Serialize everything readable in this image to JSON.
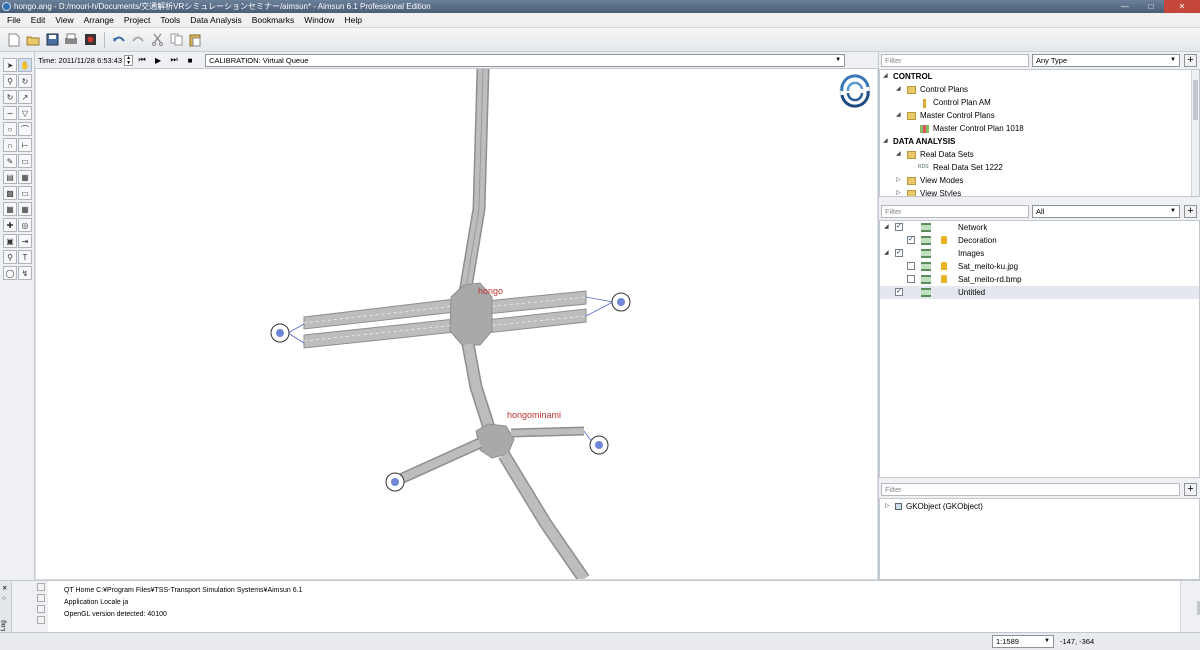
{
  "window": {
    "title": "hongo.ang - D:/mouri-h/Documents/交通解析VRシミュレーションセミナー/aimsun* - Aimsun 6.1 Professional Edition"
  },
  "menu": [
    "File",
    "Edit",
    "View",
    "Arrange",
    "Project",
    "Tools",
    "Data Analysis",
    "Bookmarks",
    "Window",
    "Help"
  ],
  "timebar": {
    "time_label": "Time: 2011/11/28 6:53:43",
    "experiment": "CALIBRATION: Virtual Queue"
  },
  "map": {
    "labels": {
      "node1": "hongo",
      "node2": "hongominami"
    }
  },
  "project_panel": {
    "filter_placeholder": "Filter",
    "type_select": "Any Type",
    "items": [
      {
        "label": "CONTROL"
      },
      {
        "label": "Control Plans"
      },
      {
        "label": "Control Plan AM"
      },
      {
        "label": "Master Control Plans"
      },
      {
        "label": "Master Control Plan 1018"
      },
      {
        "label": "DATA ANALYSIS"
      },
      {
        "label": "Real Data Sets"
      },
      {
        "label": "Real Data Set 1222",
        "badge": "RDS"
      },
      {
        "label": "View Modes"
      },
      {
        "label": "View Styles"
      }
    ]
  },
  "layers_panel": {
    "filter_placeholder": "Filter",
    "type_select": "All",
    "items": [
      {
        "label": "Network"
      },
      {
        "label": "Decoration"
      },
      {
        "label": "Images"
      },
      {
        "label": "Sat_meito-ku.jpg"
      },
      {
        "label": "Sat_meito-rd.bmp"
      },
      {
        "label": "Untitled"
      }
    ]
  },
  "properties_panel": {
    "filter_placeholder": "Filter",
    "items": [
      {
        "label": "GKObject (GKObject)"
      }
    ]
  },
  "log": {
    "tab_label": "Log",
    "lines": [
      "QT Home C:¥Program Files¥TSS-Transport Simulation Systems¥Aimsun 6.1",
      "Application Locale ja",
      "OpenGL version detected: 40100"
    ]
  },
  "status": {
    "scale": "1:1589",
    "coords": "-147, -364"
  }
}
